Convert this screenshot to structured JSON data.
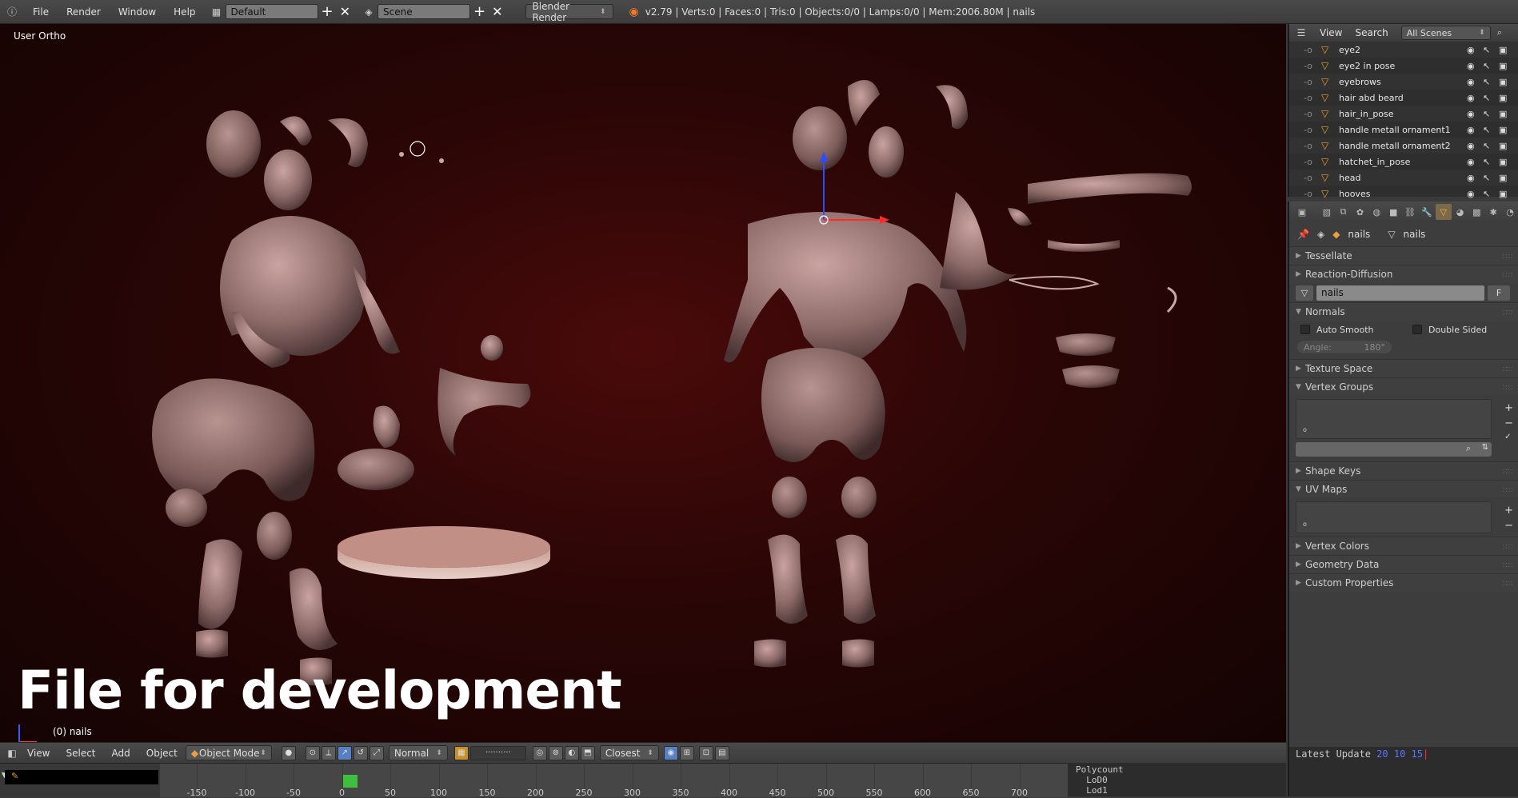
{
  "topbar": {
    "menus": [
      "File",
      "Render",
      "Window",
      "Help"
    ],
    "layout_value": "Default",
    "scene_value": "Scene",
    "engine_value": "Blender Render",
    "stats": "v2.79 | Verts:0 | Faces:0 | Tris:0 | Objects:0/0 | Lamps:0/0 | Mem:2006.80M | nails"
  },
  "viewport": {
    "view_label": "User Ortho",
    "object_label": "(0) nails",
    "overlay_title": "File for development",
    "background_color": "#3a0808"
  },
  "view_header": {
    "menus": [
      "View",
      "Select",
      "Add",
      "Object"
    ],
    "mode": "Object Mode",
    "orientation": "Normal",
    "snap_target": "Closest"
  },
  "timeline": {
    "ticks": [
      "-150",
      "-100",
      "-50",
      "0",
      "50",
      "100",
      "150",
      "200",
      "250",
      "300",
      "350",
      "400",
      "450",
      "500",
      "550",
      "600",
      "650",
      "700"
    ],
    "current_frame": 0
  },
  "polycount_panel": {
    "lines": [
      "Polycount",
      "  LoD0",
      "  Lod1"
    ]
  },
  "outliner": {
    "menus": [
      "View",
      "Search"
    ],
    "scenes_dropdown": "All Scenes",
    "rows": [
      {
        "name": "eye2"
      },
      {
        "name": "eye2 in pose"
      },
      {
        "name": "eyebrows"
      },
      {
        "name": "hair abd beard"
      },
      {
        "name": "hair_in_pose"
      },
      {
        "name": "handle metall ornament1"
      },
      {
        "name": "handle metall ornament2"
      },
      {
        "name": "hatchet_in_pose"
      },
      {
        "name": "head"
      },
      {
        "name": "hooves"
      }
    ]
  },
  "properties": {
    "breadcrumb_object": "nails",
    "breadcrumb_mesh": "nails",
    "mesh_name_value": "nails",
    "fake_user_label": "F",
    "panels": {
      "tessellate": "Tessellate",
      "reaction_diffusion": "Reaction-Diffusion",
      "normals": "Normals",
      "auto_smooth": "Auto Smooth",
      "double_sided": "Double Sided",
      "angle_label": "Angle:",
      "angle_value": "180°",
      "texture_space": "Texture Space",
      "vertex_groups": "Vertex Groups",
      "shape_keys": "Shape Keys",
      "uv_maps": "UV Maps",
      "vertex_colors": "Vertex Colors",
      "geometry_data": "Geometry Data",
      "custom_properties": "Custom Properties"
    }
  },
  "update_panel": {
    "label": "Latest Update",
    "d1": "20",
    "d2": "10",
    "d3": "15"
  },
  "icons": [
    "info-icon",
    "layout-icon",
    "scene-icon",
    "blender-logo-icon",
    "mesh-triangle-icon",
    "eye-icon",
    "cursor-icon",
    "camera-icon",
    "pin-icon",
    "cube-icon",
    "sphere-icon"
  ]
}
